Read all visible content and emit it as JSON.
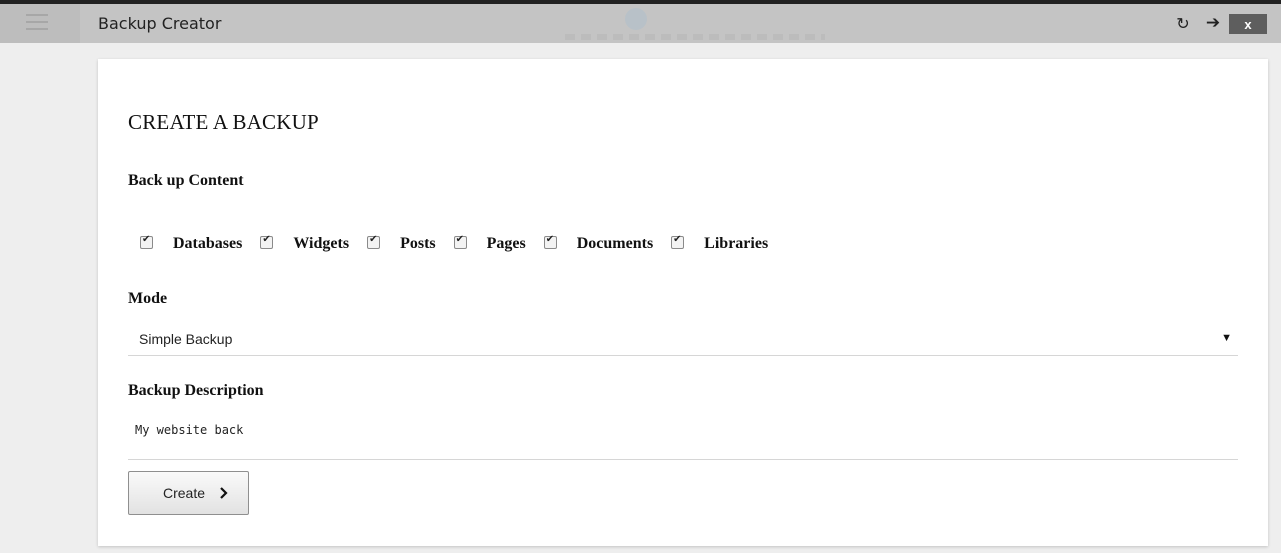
{
  "window": {
    "title": "Backup Creator",
    "refresh_glyph": "↻",
    "forward_glyph": "➔",
    "close_label": "x"
  },
  "page": {
    "title": "CREATE A BACKUP"
  },
  "content": {
    "label": "Back up Content",
    "options": [
      {
        "label": "Databases",
        "checked": true
      },
      {
        "label": "Widgets",
        "checked": true
      },
      {
        "label": "Posts",
        "checked": true
      },
      {
        "label": "Pages",
        "checked": true
      },
      {
        "label": "Documents",
        "checked": true
      },
      {
        "label": "Libraries",
        "checked": true
      }
    ]
  },
  "mode": {
    "label": "Mode",
    "selected": "Simple Backup",
    "arrow": "▼"
  },
  "description": {
    "label": "Backup Description",
    "value": "My website back"
  },
  "create_button": {
    "label": "Create"
  },
  "colors": {
    "header_bg": "#c4c4c4",
    "close_bg": "#5e5e5e",
    "page_bg": "#eeeeee",
    "card_bg": "#ffffff"
  },
  "icons": {
    "menu": "hamburger-menu-icon",
    "refresh": "refresh-icon",
    "forward": "arrow-right-icon",
    "close": "close-icon",
    "chevron": "chevron-right-icon"
  }
}
